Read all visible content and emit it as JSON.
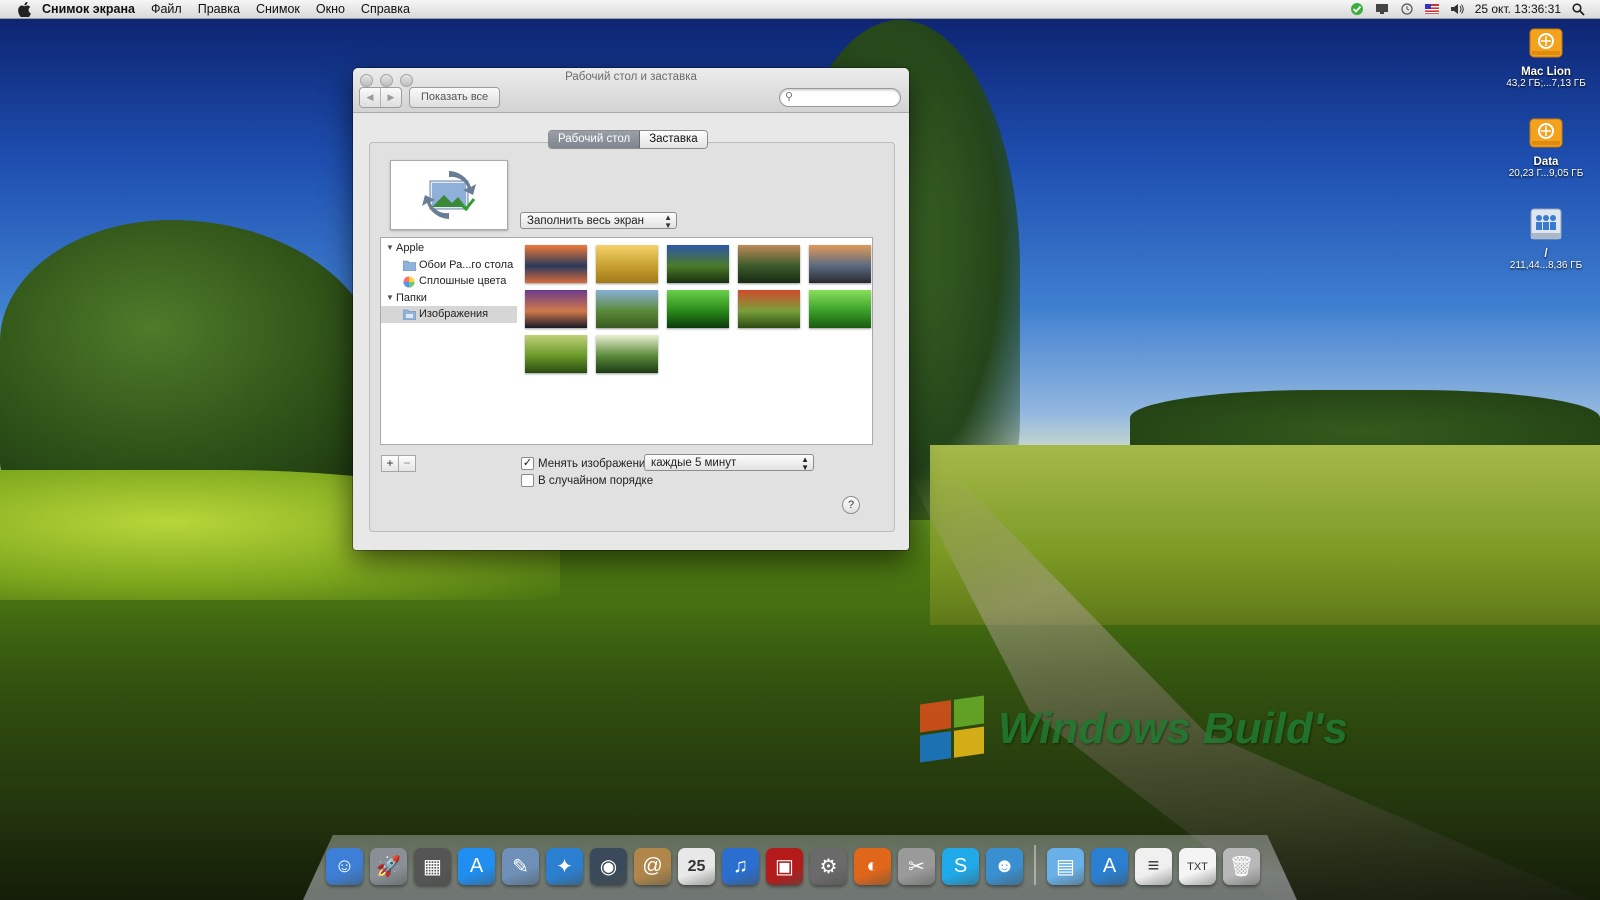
{
  "menubar": {
    "app_name": "Снимок экрана",
    "items": [
      "Файл",
      "Правка",
      "Снимок",
      "Окно",
      "Справка"
    ],
    "datetime": "25 окт.  13:36:31"
  },
  "desktop_icons": [
    {
      "name": "Mac Lion",
      "info": "43,2 ГБ;...7,13 ГБ"
    },
    {
      "name": "Data",
      "info": "20,23 Г...9,05 ГБ"
    },
    {
      "name": "/",
      "info": "211,44...8,36 ГБ"
    }
  ],
  "window": {
    "title": "Рабочий стол и заставка",
    "show_all": "Показать все",
    "search_placeholder": "",
    "tabs": [
      "Рабочий стол",
      "Заставка"
    ],
    "fit_option": "Заполнить весь экран",
    "source_list": {
      "group1": "Apple",
      "item1": "Обои Ра...го стола",
      "item2": "Сплошные цвета",
      "group2": "Папки",
      "item3": "Изображения"
    },
    "change_picture_label": "Менять изображение:",
    "change_picture_checked": true,
    "interval": "каждые 5 минут",
    "random_label": "В случайном порядке",
    "random_checked": false,
    "add": "+",
    "remove": "−",
    "help": "?"
  },
  "watermark": "Windows Build's",
  "thumbnails": [
    {
      "c1": "#f07a3a",
      "c2": "#2b3a5a",
      "c3": "#d86a40"
    },
    {
      "c1": "#f3d26a",
      "c2": "#c8a030",
      "c3": "#a07a1a"
    },
    {
      "c1": "#2c57a8",
      "c2": "#4a7a2a",
      "c3": "#1a3010"
    },
    {
      "c1": "#c08a5a",
      "c2": "#3a5a2a",
      "c3": "#1a2a14"
    },
    {
      "c1": "#e09a5a",
      "c2": "#5a6a80",
      "c3": "#2a2a30"
    },
    {
      "c1": "#6a3a8a",
      "c2": "#d07a4a",
      "c3": "#1a1a2a"
    },
    {
      "c1": "#8ab0d8",
      "c2": "#5a8a3a",
      "c3": "#3a5a20"
    },
    {
      "c1": "#6ad04a",
      "c2": "#2a8a1a",
      "c3": "#0a3a0a"
    },
    {
      "c1": "#d04a2a",
      "c2": "#7aa03a",
      "c3": "#2a4a10"
    },
    {
      "c1": "#8ae05a",
      "c2": "#3aa02a",
      "c3": "#1a5a10"
    },
    {
      "c1": "#c0d07a",
      "c2": "#6a9a2a",
      "c3": "#2a4a10"
    },
    {
      "c1": "#e8f0d0",
      "c2": "#5a8a3a",
      "c3": "#1a3a14"
    }
  ],
  "dock": [
    {
      "icon": "finder-icon",
      "color": "#3d7fd6",
      "glyph": "☺"
    },
    {
      "icon": "launchpad-icon",
      "color": "#8a8f96",
      "glyph": "🚀"
    },
    {
      "icon": "photo-booth-icon",
      "color": "#555",
      "glyph": "▦"
    },
    {
      "icon": "app-store-icon",
      "color": "#1f8ef0",
      "glyph": "A"
    },
    {
      "icon": "preview-icon",
      "color": "#6d8fb8",
      "glyph": "✎"
    },
    {
      "icon": "safari-icon",
      "color": "#2a7fd0",
      "glyph": "✦"
    },
    {
      "icon": "facetime-icon",
      "color": "#3a4a5a",
      "glyph": "◉"
    },
    {
      "icon": "address-book-icon",
      "color": "#b0864a",
      "glyph": "@"
    },
    {
      "icon": "ical-icon",
      "color": "#e8e8e8",
      "glyph": "25"
    },
    {
      "icon": "itunes-icon",
      "color": "#2a6fd0",
      "glyph": "♫"
    },
    {
      "icon": "photo-icon",
      "color": "#b51a1a",
      "glyph": "▣"
    },
    {
      "icon": "system-preferences-icon",
      "color": "#6a6a6a",
      "glyph": "⚙"
    },
    {
      "icon": "firefox-icon",
      "color": "#e0661a",
      "glyph": "◐"
    },
    {
      "icon": "utility-icon",
      "color": "#9a9a9a",
      "glyph": "✂"
    },
    {
      "icon": "skype-icon",
      "color": "#1fa9e8",
      "glyph": "S"
    },
    {
      "icon": "messenger-icon",
      "color": "#3a8fd0",
      "glyph": "☻"
    },
    {
      "icon": "sep",
      "color": "",
      "glyph": ""
    },
    {
      "icon": "applications-folder-icon",
      "color": "#6ab0e8",
      "glyph": "▤"
    },
    {
      "icon": "app-store-downloads-icon",
      "color": "#2a7fd0",
      "glyph": "A"
    },
    {
      "icon": "document-icon",
      "color": "#f0f0f0",
      "glyph": "≡"
    },
    {
      "icon": "txt-document-icon",
      "color": "#f4f4f4",
      "glyph": "TXT"
    },
    {
      "icon": "trash-icon",
      "color": "#b8b8b8",
      "glyph": "🗑"
    }
  ]
}
